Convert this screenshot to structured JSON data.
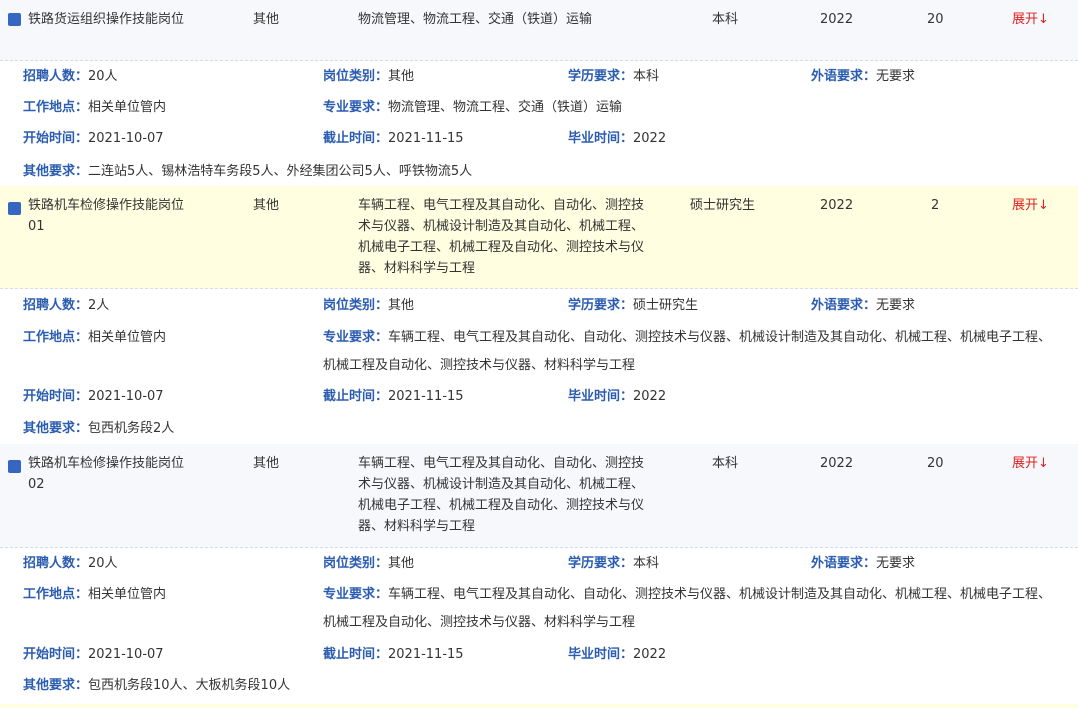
{
  "labels": {
    "headcount": "招聘人数：",
    "category": "岗位类别：",
    "education": "学历要求：",
    "language": "外语要求：",
    "location": "工作地点：",
    "major": "专业要求：",
    "start": "开始时间：",
    "deadline": "截止时间：",
    "grad": "毕业时间：",
    "other": "其他要求："
  },
  "jobs": [
    {
      "title": "铁路货运组织操作技能岗位",
      "category": "其他",
      "major": "物流管理、物流工程、交通（铁道）运输",
      "education": "本科",
      "year": "2022",
      "count": "20",
      "toggle": "展开↓",
      "detail": {
        "headcount": "20人",
        "category": "其他",
        "education": "本科",
        "language": "无要求",
        "location": "相关单位管内",
        "major": "物流管理、物流工程、交通（铁道）运输",
        "start": "2021-10-07",
        "deadline": "2021-11-15",
        "grad": "2022",
        "other": "二连站5人、锡林浩特车务段5人、外经集团公司5人、呼铁物流5人"
      }
    },
    {
      "title": "铁路机车检修操作技能岗位01",
      "category": "其他",
      "major": "车辆工程、电气工程及其自动化、自动化、测控技术与仪器、机械设计制造及其自动化、机械工程、机械电子工程、机械工程及自动化、测控技术与仪器、材料科学与工程",
      "education": "硕士研究生",
      "year": "2022",
      "count": "2",
      "toggle": "展开↓",
      "detail": {
        "headcount": "2人",
        "category": "其他",
        "education": "硕士研究生",
        "language": "无要求",
        "location": "相关单位管内",
        "major": "车辆工程、电气工程及其自动化、自动化、测控技术与仪器、机械设计制造及其自动化、机械工程、机械电子工程、机械工程及自动化、测控技术与仪器、材料科学与工程",
        "start": "2021-10-07",
        "deadline": "2021-11-15",
        "grad": "2022",
        "other": "包西机务段2人"
      }
    },
    {
      "title": "铁路机车检修操作技能岗位02",
      "category": "其他",
      "major": "车辆工程、电气工程及其自动化、自动化、测控技术与仪器、机械设计制造及其自动化、机械工程、机械电子工程、机械工程及自动化、测控技术与仪器、材料科学与工程",
      "education": "本科",
      "year": "2022",
      "count": "20",
      "toggle": "展开↓",
      "detail": {
        "headcount": "20人",
        "category": "其他",
        "education": "本科",
        "language": "无要求",
        "location": "相关单位管内",
        "major": "车辆工程、电气工程及其自动化、自动化、测控技术与仪器、机械设计制造及其自动化、机械工程、机械电子工程、机械工程及自动化、测控技术与仪器、材料科学与工程",
        "start": "2021-10-07",
        "deadline": "2021-11-15",
        "grad": "2022",
        "other": "包西机务段10人、大板机务段10人"
      }
    }
  ]
}
